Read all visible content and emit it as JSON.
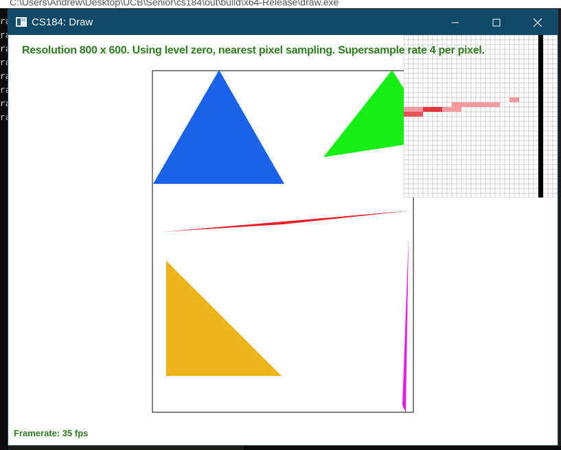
{
  "background": {
    "console_title": "C:\\Users\\Andrew\\Desktop\\UCB\\Senior\\cs184\\out\\build\\x64-Release\\draw.exe",
    "console_lines": [
      "ra",
      "ra",
      "ra",
      "ra",
      "ra",
      "ra",
      "ra",
      "ra"
    ]
  },
  "window": {
    "title": "CS184: Draw",
    "icon": "app-window-icon",
    "controls": [
      "minimize-icon",
      "maximize-icon",
      "close-icon"
    ]
  },
  "hud": {
    "info": "Resolution 800 x 600. Using level zero, nearest pixel sampling. Supersample rate 4 per pixel.",
    "framerate": "Framerate: 35 fps"
  },
  "colors": {
    "title_bar": "#0e4a68",
    "hud_text": "#2e7d1f",
    "blue": "#1a63e8",
    "green": "#16ee16",
    "red": "#ee1a24",
    "orange": "#ecb41a",
    "magenta": "#e81ae8"
  }
}
